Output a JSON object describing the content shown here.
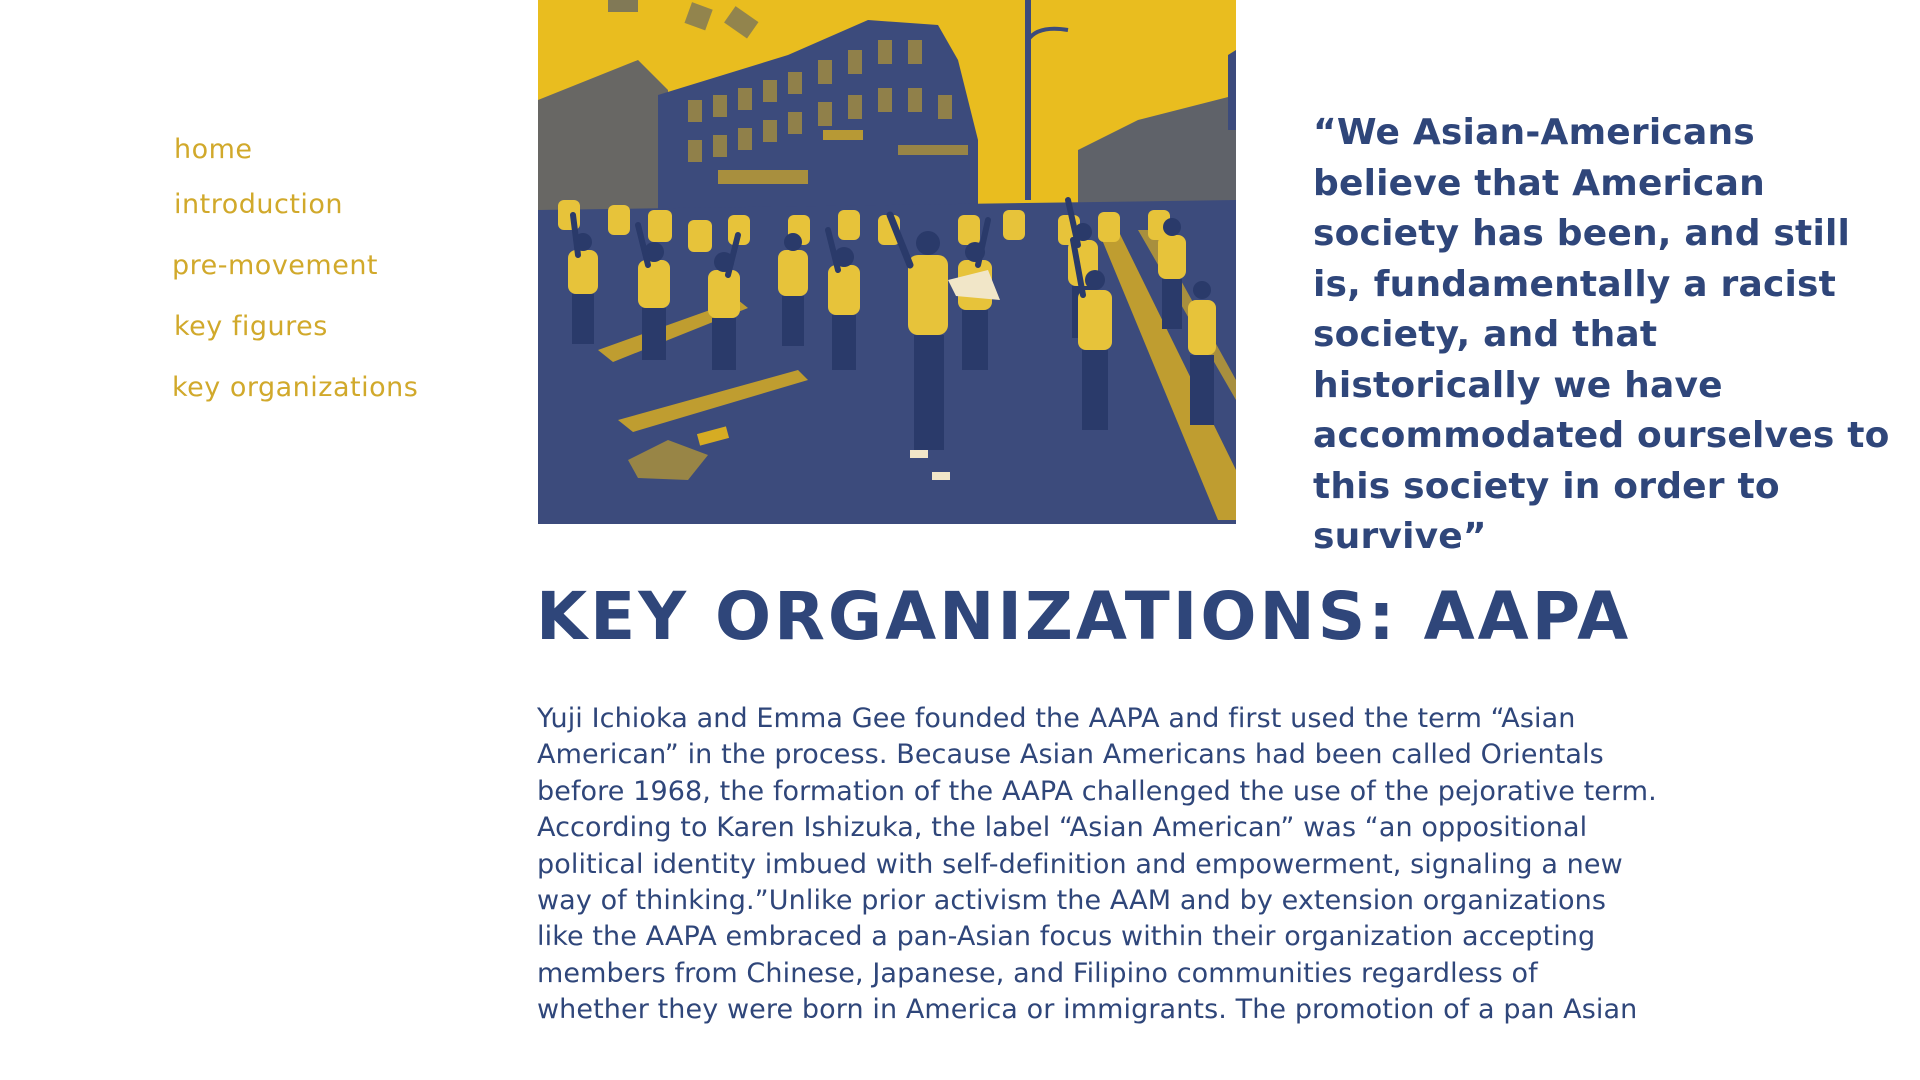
{
  "nav": {
    "items": [
      {
        "label": "home"
      },
      {
        "label": "introduction"
      },
      {
        "label": "pre-movement"
      },
      {
        "label": "key figures"
      },
      {
        "label": "key organizations"
      }
    ]
  },
  "hero": {
    "icon": "protest-march-photo"
  },
  "quote": {
    "text": "“We Asian-Americans believe that American society has been, and still is, fundamentally a racist society, and that historically we have accommodated ourselves to this society in order to survive”"
  },
  "main": {
    "title": "KEY ORGANIZATIONS: AAPA",
    "body": "Yuji Ichioka and Emma Gee founded the AAPA and first used the term “Asian American” in the process. Because Asian Americans had been called Orientals before 1968, the formation of the AAPA challenged the use of the pejorative term. According to Karen Ishizuka, the label “Asian American” was “an oppositional political identity imbued with self-definition and empowerment, signaling a new way of thinking.”Unlike prior activism the AAM and by extension organizations like the AAPA embraced a pan-Asian focus within their organization accepting members from Chinese, Japanese, and Filipino communities regardless of whether they were born in America or immigrants. The promotion of a pan Asian"
  },
  "colors": {
    "accent_gold": "#d1a92b",
    "primary_navy": "#2f467a",
    "duotone_yellow": "#e9bd1f",
    "duotone_blue": "#3c4b7c",
    "background": "#ffffff"
  }
}
